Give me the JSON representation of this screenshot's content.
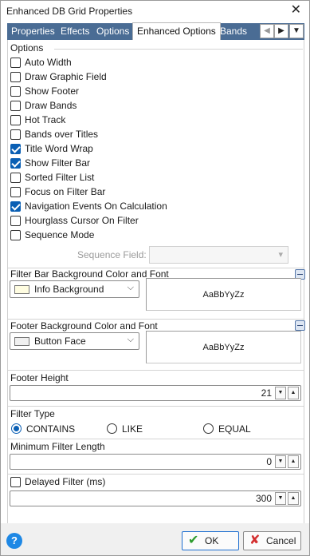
{
  "window": {
    "title": "Enhanced DB Grid Properties",
    "close_glyph": "✕"
  },
  "tabs": [
    "Properties",
    "Effects",
    "Options",
    "Enhanced Options",
    "Bands"
  ],
  "tab_nav": {
    "prev": "◀",
    "next": "▶",
    "menu": "▼"
  },
  "options": {
    "title": "Options",
    "items": [
      {
        "label": "Auto Width",
        "checked": false
      },
      {
        "label": "Draw Graphic Field",
        "checked": false
      },
      {
        "label": "Show Footer",
        "checked": false
      },
      {
        "label": "Draw Bands",
        "checked": false
      },
      {
        "label": "Hot Track",
        "checked": false
      },
      {
        "label": "Bands over Titles",
        "checked": false
      },
      {
        "label": "Title Word Wrap",
        "checked": true
      },
      {
        "label": "Show Filter Bar",
        "checked": true
      },
      {
        "label": "Sorted Filter List",
        "checked": false
      },
      {
        "label": "Focus on Filter Bar",
        "checked": false
      },
      {
        "label": "Navigation Events On Calculation",
        "checked": true
      },
      {
        "label": "Hourglass Cursor On Filter",
        "checked": false
      },
      {
        "label": "Sequence Mode",
        "checked": false
      }
    ],
    "sequence_field_label": "Sequence Field:",
    "sequence_field_value": ""
  },
  "filter_bar": {
    "title": "Filter Bar Background Color and Font",
    "color_name": "Info Background",
    "swatch": "#fffde1",
    "font_sample": "AaBbYyZz"
  },
  "footer_bg": {
    "title": "Footer Background Color and Font",
    "color_name": "Button Face",
    "swatch": "#f0f0f0",
    "font_sample": "AaBbYyZz"
  },
  "footer_height": {
    "title": "Footer Height",
    "value": "21"
  },
  "filter_type": {
    "title": "Filter Type",
    "options": [
      {
        "label": "CONTAINS",
        "selected": true
      },
      {
        "label": "LIKE",
        "selected": false
      },
      {
        "label": "EQUAL",
        "selected": false
      }
    ]
  },
  "min_filter_length": {
    "title": "Minimum Filter Length",
    "value": "0"
  },
  "delayed_filter": {
    "label": "Delayed Filter (ms)",
    "checked": false,
    "value": "300"
  },
  "buttons": {
    "help": "?",
    "ok": "OK",
    "cancel": "Cancel",
    "ok_icon": "✔",
    "cancel_icon": "✘"
  },
  "colors": {
    "tab_strip": "#4a6c94",
    "accent": "#0a5fb4",
    "ok_icon": "#2e9c2e",
    "cancel_icon": "#d32f2f"
  }
}
